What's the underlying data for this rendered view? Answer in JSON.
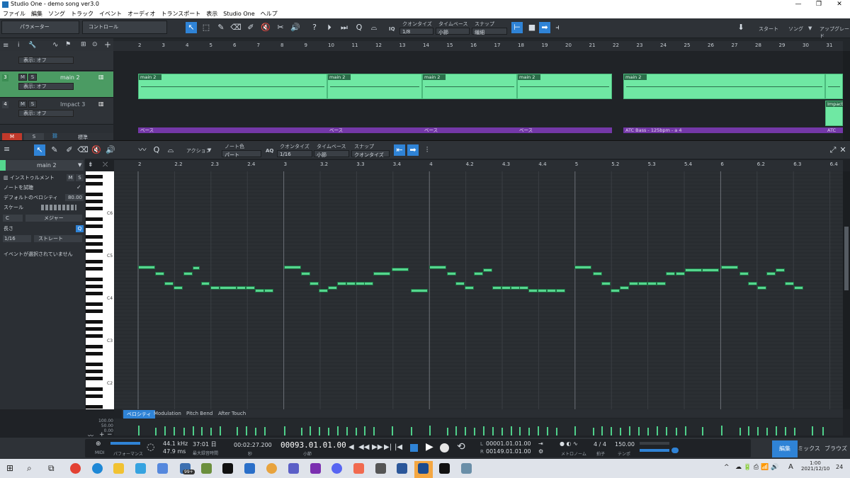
{
  "window": {
    "title": "Studio One - demo song ver3.0"
  },
  "menu": [
    "ファイル",
    "編集",
    "ソング",
    "トラック",
    "イベント",
    "オーディオ",
    "トランスポート",
    "表示",
    "Studio One",
    "ヘルプ"
  ],
  "toolbar": {
    "parameter_label": "パラメーター",
    "control_label": "コントロール",
    "quantize_label": "クオンタイズ",
    "quantize_value": "1/8",
    "timebase_label": "タイムベース",
    "timebase_value": "小節",
    "snap_label": "スナップ",
    "snap_value": "繊細",
    "iq": "IQ",
    "start": "スタート",
    "song": "ソング",
    "upgrade": "アップグレード"
  },
  "arrangement": {
    "ruler": [
      "2",
      "3",
      "4",
      "5",
      "6",
      "7",
      "8",
      "9",
      "10",
      "11",
      "12",
      "13",
      "14",
      "15",
      "16",
      "17",
      "18",
      "19",
      "20",
      "21",
      "22",
      "23",
      "24",
      "25",
      "26",
      "27",
      "28",
      "29",
      "30",
      "31"
    ],
    "tracks": [
      {
        "num": "",
        "name": "",
        "view": "表示: オフ"
      },
      {
        "num": "3",
        "name": "main 2",
        "view": "表示: オフ"
      },
      {
        "num": "4",
        "name": "Impact 3",
        "view": "表示: オフ"
      }
    ],
    "clip_label": "main 2",
    "impact_label": "Impact",
    "bass_labels": [
      "ベース",
      "ベース",
      "ベース",
      "ベース",
      "ATC Bass - 125bpm - a 4",
      "ATC Ba"
    ],
    "bottom_m": "M",
    "bottom_s": "S",
    "standard": "標準"
  },
  "editor_bar": {
    "action": "アクション",
    "note_color_label": "ノート色",
    "note_color_value": "パート",
    "aq": "AQ",
    "quantize_label": "クオンタイズ",
    "quantize_value": "1/16",
    "timebase_label": "タイムベース",
    "timebase_value": "小節",
    "snap_label": "スナップ",
    "snap_value": "クオンタイズ"
  },
  "inspector": {
    "part_name": "main 2",
    "instrument": "インストゥルメント",
    "m": "M",
    "s": "S",
    "note_trial": "ノートを試聴",
    "default_velocity_label": "デフォルトのベロシティ",
    "default_velocity": "80.00",
    "scale_label": "スケール",
    "scale_root": "C",
    "scale_type": "メジャー",
    "length_label": "長さ",
    "q": "Q",
    "length_value": "1/16",
    "length_mode": "ストレート",
    "no_event": "イベントが選択されていません"
  },
  "piano_roll": {
    "ruler": [
      "2",
      "2.2",
      "2.3",
      "2.4",
      "3",
      "3.2",
      "3.3",
      "3.4",
      "4",
      "4.2",
      "4.3",
      "4.4",
      "5",
      "5.2",
      "5.3",
      "5.4",
      "6",
      "6.2",
      "6.3",
      "6.4"
    ],
    "octave_labels": [
      "C6",
      "C5",
      "C4",
      "C3",
      "C2"
    ]
  },
  "velocity_lane": {
    "tabs": [
      "ベロシティ",
      "Modulation",
      "Pitch Bend",
      "After Touch"
    ],
    "scale": [
      "100.00",
      "50.00",
      "0.00"
    ]
  },
  "transport": {
    "midi": "MIDI",
    "performance": "パフォーマンス",
    "sample_rate": "44.1 kHz",
    "latency": "47.9 ms",
    "record_time": "37:01 日",
    "record_time_label": "最大録音時間",
    "time": "00:02:27.200",
    "time_label": "秒",
    "bars": "00093.01.01.00",
    "bars_label": "小節",
    "loop_l": "00001.01.01.00",
    "loop_r": "00149.01.01.00",
    "metronome_label": "メトロノーム",
    "signature": "4 / 4",
    "signature_label": "拍子",
    "tempo": "150.00",
    "tempo_label": "テンポ",
    "tab_edit": "編集",
    "tab_mix": "ミックス",
    "tab_browse": "ブラウズ",
    "l": "L",
    "r": "R"
  },
  "taskbar": {
    "clock_time": "1:00",
    "clock_date": "2021/12/10",
    "badge": "99+",
    "notifications": "24",
    "ime": "A"
  },
  "colors": {
    "accent": "#2f83d6",
    "note_green": "#55d68e",
    "clip_green": "#6fe8a3",
    "bass_purple": "#7438a8",
    "mute_red": "#c0392b"
  }
}
